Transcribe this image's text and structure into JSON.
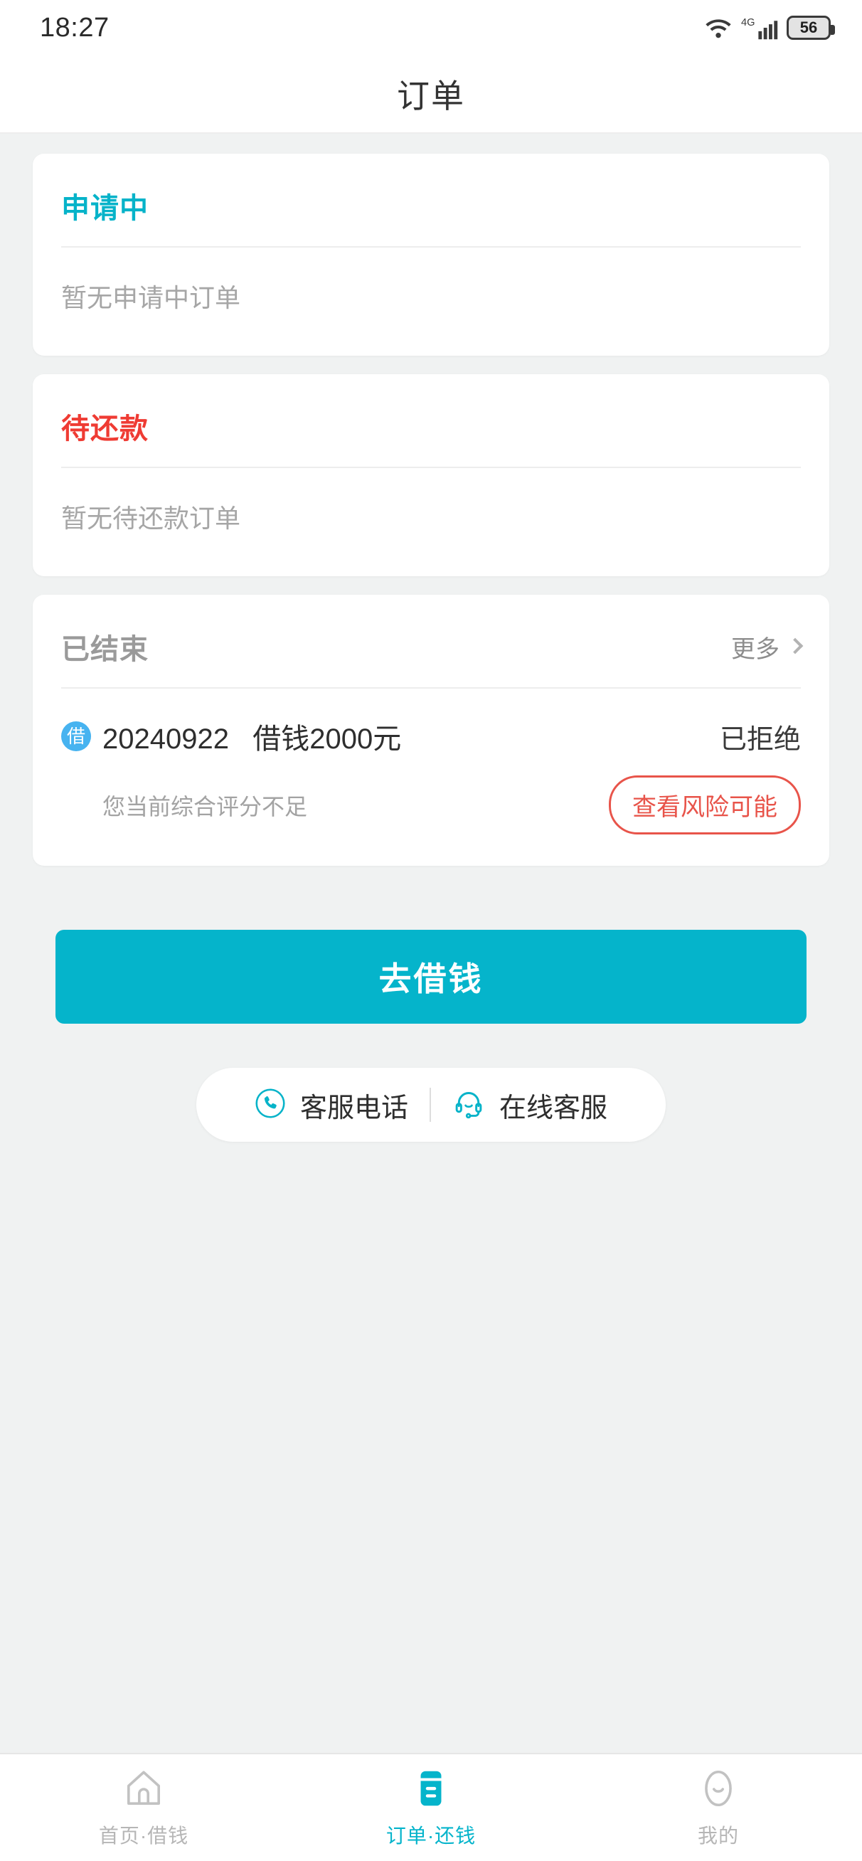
{
  "status_bar": {
    "time": "18:27",
    "network_label": "4G",
    "battery_level": "56",
    "wifi_icon": "wifi-icon",
    "signal_icon": "signal-bars-icon",
    "battery_icon": "battery-icon"
  },
  "header": {
    "title": "订单"
  },
  "cards": [
    {
      "heading": "申请中",
      "heading_color": "#06b3c9",
      "empty_text": "暂无申请中订单"
    },
    {
      "heading": "待还款",
      "heading_color": "#ef3b33",
      "empty_text": "暂无待还款订单"
    }
  ],
  "finished_card": {
    "heading": "已结束",
    "heading_color": "#9a9a9a",
    "more_label": "更多",
    "more_icon": "chevron-right-icon",
    "orders": [
      {
        "badge_text": "借",
        "badge_color": "#47b3f0",
        "title": "20240922   借钱2000元",
        "status": "已拒绝",
        "note": "您当前综合评分不足",
        "action_label": "查看风险可能",
        "action_color": "#e8544a"
      }
    ]
  },
  "cta": {
    "label": "去借钱",
    "color": "#05b4cb"
  },
  "support": {
    "items": [
      {
        "label": "客服电话",
        "icon": "phone-circle-icon"
      },
      {
        "label": "在线客服",
        "icon": "headset-icon"
      }
    ]
  },
  "tabbar": {
    "active_color": "#05b4cb",
    "inactive_color": "#b6b6b6",
    "items": [
      {
        "label": "首页·借钱",
        "icon": "home-icon",
        "active": false
      },
      {
        "label": "订单·还钱",
        "icon": "orders-icon",
        "active": true
      },
      {
        "label": "我的",
        "icon": "profile-smiley-icon",
        "active": false
      }
    ]
  }
}
